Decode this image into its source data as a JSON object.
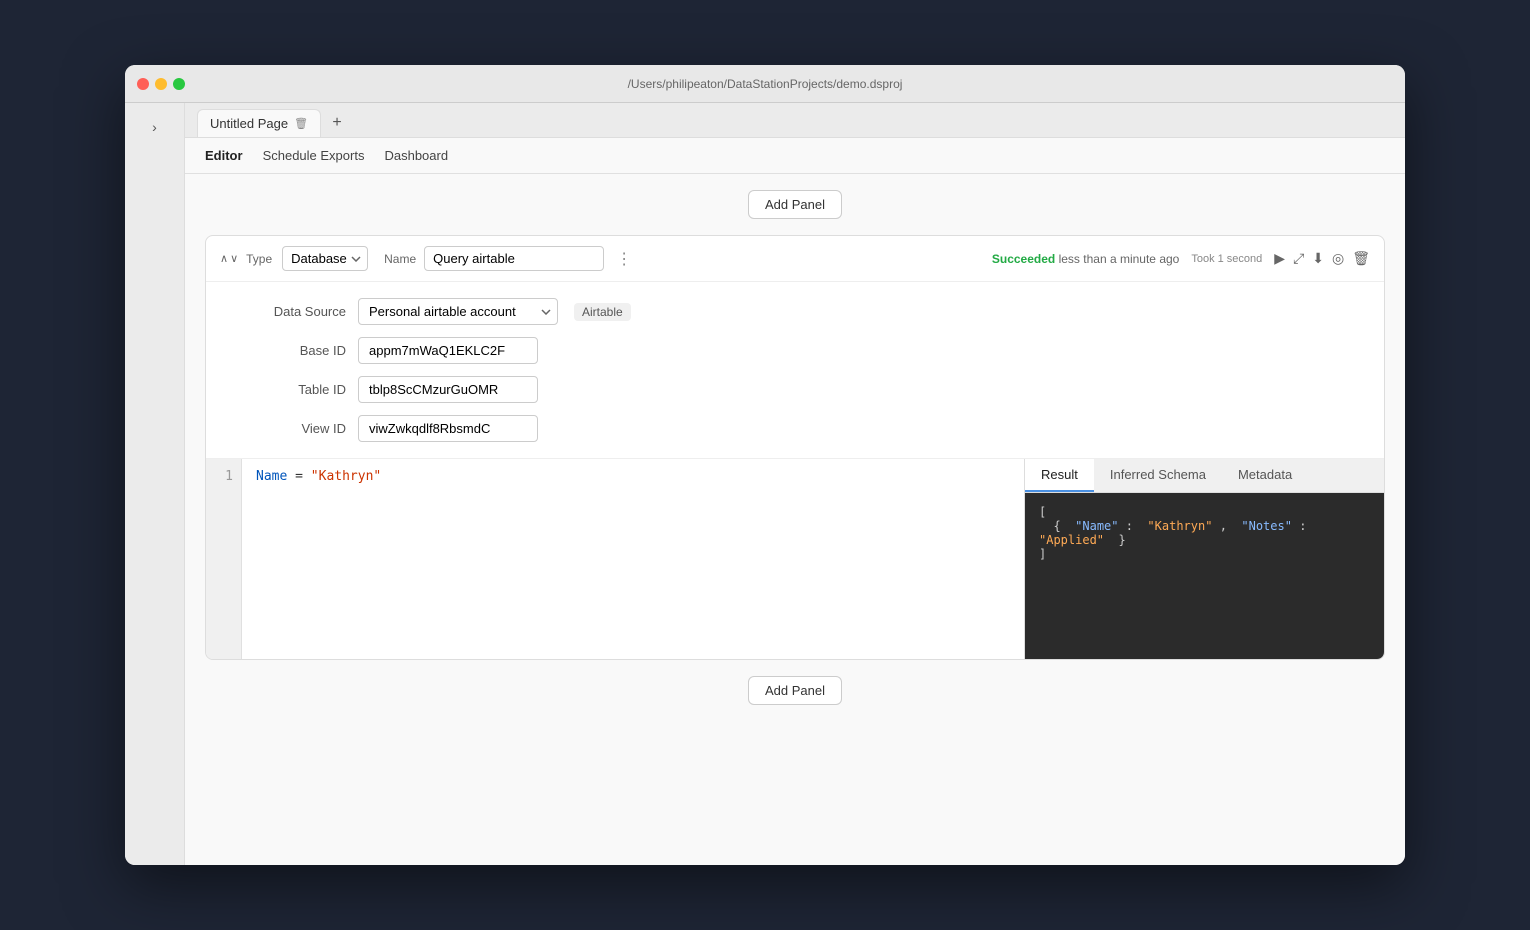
{
  "window": {
    "titlebar_text": "/Users/philipeaton/DataStationProjects/demo.dsproj"
  },
  "tabs": {
    "page_name": "Untitled Page",
    "add_label": "+"
  },
  "nav": {
    "editor_label": "Editor",
    "schedule_exports_label": "Schedule Exports",
    "dashboard_label": "Dashboard",
    "active": "editor"
  },
  "add_panel": {
    "label": "Add Panel"
  },
  "panel": {
    "type_label": "Type",
    "type_value": "Database",
    "name_label": "Name",
    "name_value": "Query airtable",
    "menu_icon": "⋮",
    "status_success": "Succeeded",
    "status_time": "less than a minute ago",
    "status_detail": "Took 1 second",
    "data_source_label": "Data Source",
    "data_source_value": "Personal airtable account",
    "datasource_badge": "Airtable",
    "base_id_label": "Base ID",
    "base_id_value": "appm7mWaQ1EKLC2F",
    "table_id_label": "Table ID",
    "table_id_value": "tblp8ScCMzurGuOMR",
    "view_id_label": "View ID",
    "view_id_value": "viwZwkqdlf8RbsmdC",
    "code_line1": "Name",
    "code_equals": "=",
    "code_string": "\"Kathryn\"",
    "line_number": "1"
  },
  "result": {
    "tab_result": "Result",
    "tab_inferred": "Inferred Schema",
    "tab_metadata": "Metadata",
    "active_tab": "Result",
    "json_open_bracket": "[",
    "json_open_brace": "  {",
    "json_name_key": "\"Name\"",
    "json_colon1": ":",
    "json_name_value": "\"Kathryn\"",
    "json_comma": ",",
    "json_notes_key": "\"Notes\"",
    "json_colon2": ":",
    "json_notes_value": "\"Applied\"",
    "json_close_brace": "  }",
    "json_close_bracket": "]"
  },
  "bottom_add_panel": {
    "label": "Add Panel"
  }
}
